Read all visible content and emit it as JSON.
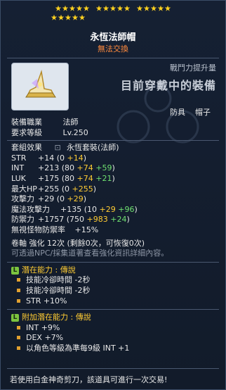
{
  "stars": {
    "filled": 20,
    "total": 20
  },
  "item": {
    "name": "永恆法師帽",
    "trade_status": "無法交換",
    "power_label": "戰鬥力提升量",
    "equipped_label": "目前穿戴中的裝備",
    "categories": [
      "防具",
      "帽子"
    ]
  },
  "info": {
    "job_label": "裝備職業",
    "job_value": "法師",
    "level_label": "要求等級",
    "level_value": "Lv.250",
    "set_label": "套組效果",
    "set_value": "永恆套裝(法師)"
  },
  "stats": [
    {
      "label": "STR",
      "total": "+14",
      "base": "0",
      "plus": "+14"
    },
    {
      "label": "INT",
      "total": "+213",
      "base": "80",
      "flame": "+74",
      "star": "+59"
    },
    {
      "label": "LUK",
      "total": "+175",
      "base": "80",
      "flame": "+74",
      "star": "+21"
    },
    {
      "label": "最大HP",
      "total": "+255",
      "base": "0",
      "plus": "+255"
    },
    {
      "label": "攻擊力",
      "total": "+29",
      "base": "0",
      "plus": "+29"
    },
    {
      "label": "魔法攻擊力",
      "total": "+135",
      "base": "10",
      "flame": "+29",
      "star": "+96"
    },
    {
      "label": "防禦力",
      "total": "+1757",
      "base": "750",
      "flame": "+983",
      "star": "+24"
    }
  ],
  "ignore_def": {
    "label": "無視怪物防禦率",
    "value": "+15%"
  },
  "upgrade": {
    "text": "卷軸 強化 12次 (剩餘0次，可恢復0次)"
  },
  "hint": "可透過NPC/採集道著查看強化資訊詳細內容。",
  "potential": {
    "title": "潛在能力 : 傳說",
    "badge": "L",
    "lines": [
      "技能冷卻時間 -2秒",
      "技能冷卻時間 -2秒",
      "STR +10%"
    ]
  },
  "bonus_potential": {
    "title": "附加潛在能力 : 傳說",
    "badge": "L",
    "lines": [
      "INT +9%",
      "DEX +7%",
      "以角色等級為準每9級 INT +1"
    ]
  },
  "notice": "若使用白金神奇剪刀，該道具可進行一次交易!",
  "colors": {
    "star": "#ffd21f",
    "orange": "#ff8a3d",
    "gold": "#ffcc33",
    "green": "#6fe06f",
    "purple": "#b8a2ff",
    "legend": "#7cc43f"
  }
}
